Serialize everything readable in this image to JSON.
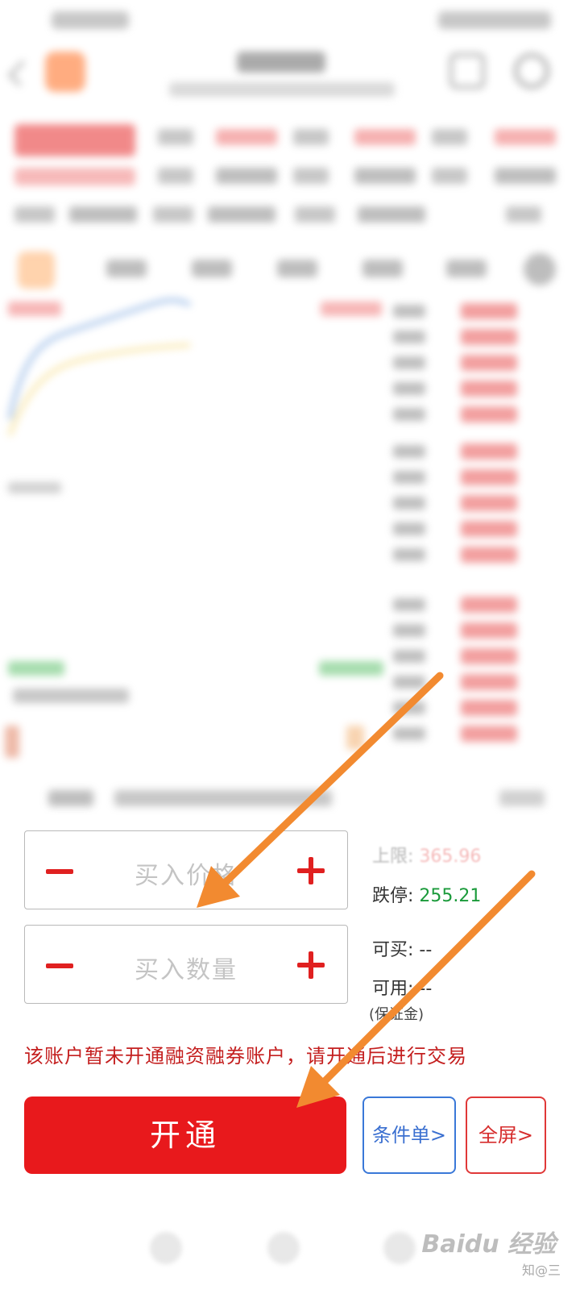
{
  "trade_panel": {
    "price_input": {
      "placeholder": "买入价格"
    },
    "quantity_input": {
      "placeholder": "买入数量"
    },
    "limit_up": {
      "label": "上限:",
      "value": "365.96"
    },
    "limit_down": {
      "label": "跌停:",
      "value": "255.21"
    },
    "can_buy": {
      "label": "可买:",
      "value": "--"
    },
    "available": {
      "label": "可用:",
      "value": "--",
      "note": "(保证金)"
    },
    "notice": "该账户暂未开通融资融券账户，请开通后进行交易",
    "open_button": "开通",
    "condition_button": "条件单>",
    "fullscreen_button": "全屏>"
  },
  "watermark": {
    "brand": "Baidu 经验",
    "sub": "知@三"
  },
  "colors": {
    "primary_red": "#e8191c",
    "down_green": "#1a9a3a",
    "link_blue": "#3a6fd0",
    "arrow_orange": "#f28a30"
  }
}
